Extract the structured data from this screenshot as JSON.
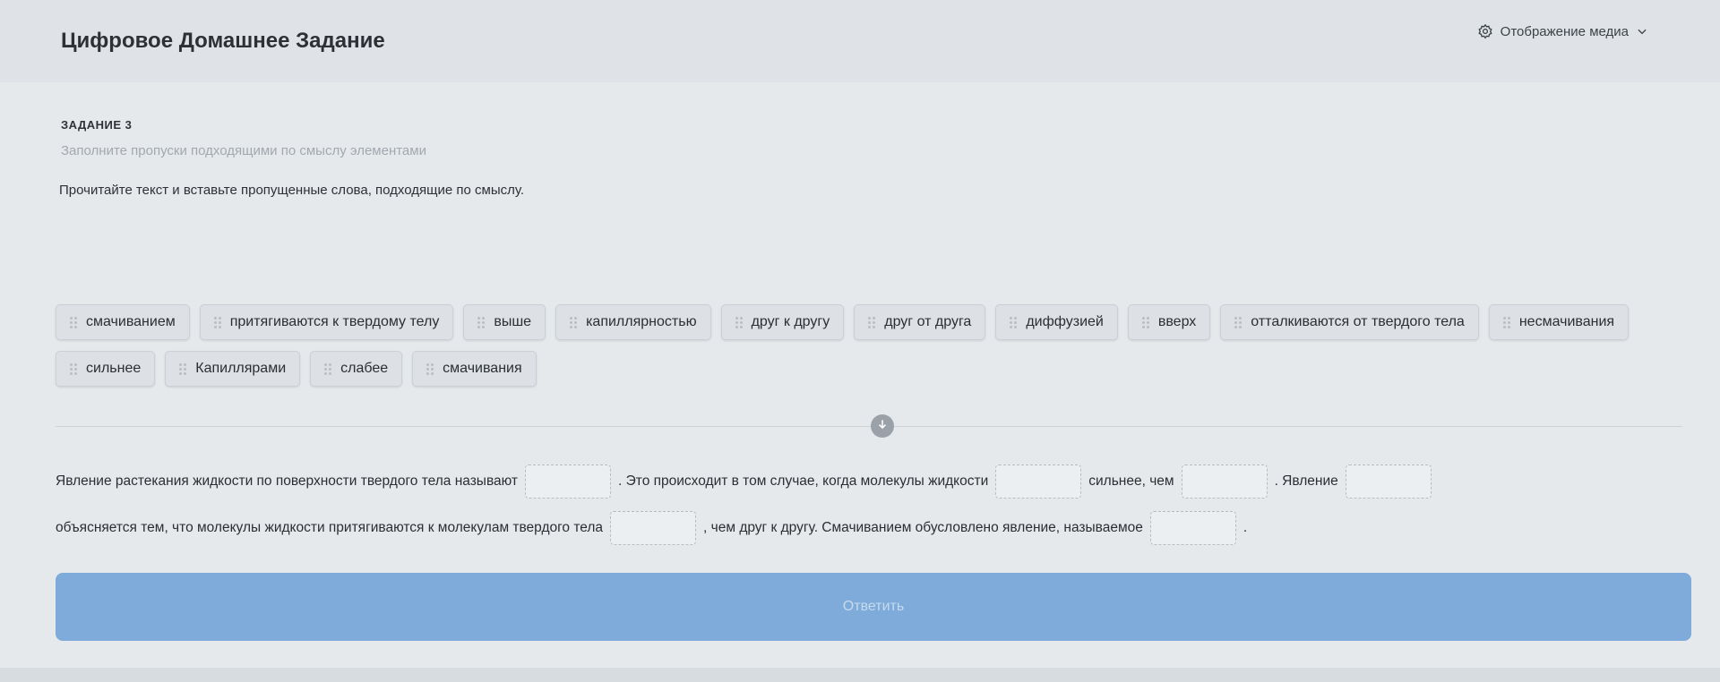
{
  "header": {
    "title": "Цифровое Домашнее Задание",
    "media_toggle_label": "Отображение медиа"
  },
  "task": {
    "label": "ЗАДАНИЕ 3",
    "subtitle": "Заполните пропуски подходящими по смыслу элементами",
    "instruction": "Прочитайте текст и вставьте пропущенные слова, подходящие по смыслу."
  },
  "options": [
    "смачиванием",
    "притягиваются к твердому телу",
    "выше",
    "капиллярностью",
    "друг к другу",
    "друг от друга",
    "диффузией",
    "вверх",
    "отталкиваются от твердого тела",
    "несмачивания",
    "сильнее",
    "Капиллярами",
    "слабее",
    "смачивания"
  ],
  "text_segments": [
    "Явление растекания жидкости по поверхности твердого тела называют",
    ". Это происходит в том случае, когда молекулы жидкости",
    "сильнее, чем",
    ". Явление",
    "объясняется тем, что молекулы жидкости притягиваются к молекулам твердого тела",
    ", чем друг к другу. Смачиванием обусловлено явление, называемое",
    "."
  ],
  "submit_label": "Ответить",
  "colors": {
    "submit_bg": "#7eabd9",
    "page_bg": "#e6e9ec"
  }
}
